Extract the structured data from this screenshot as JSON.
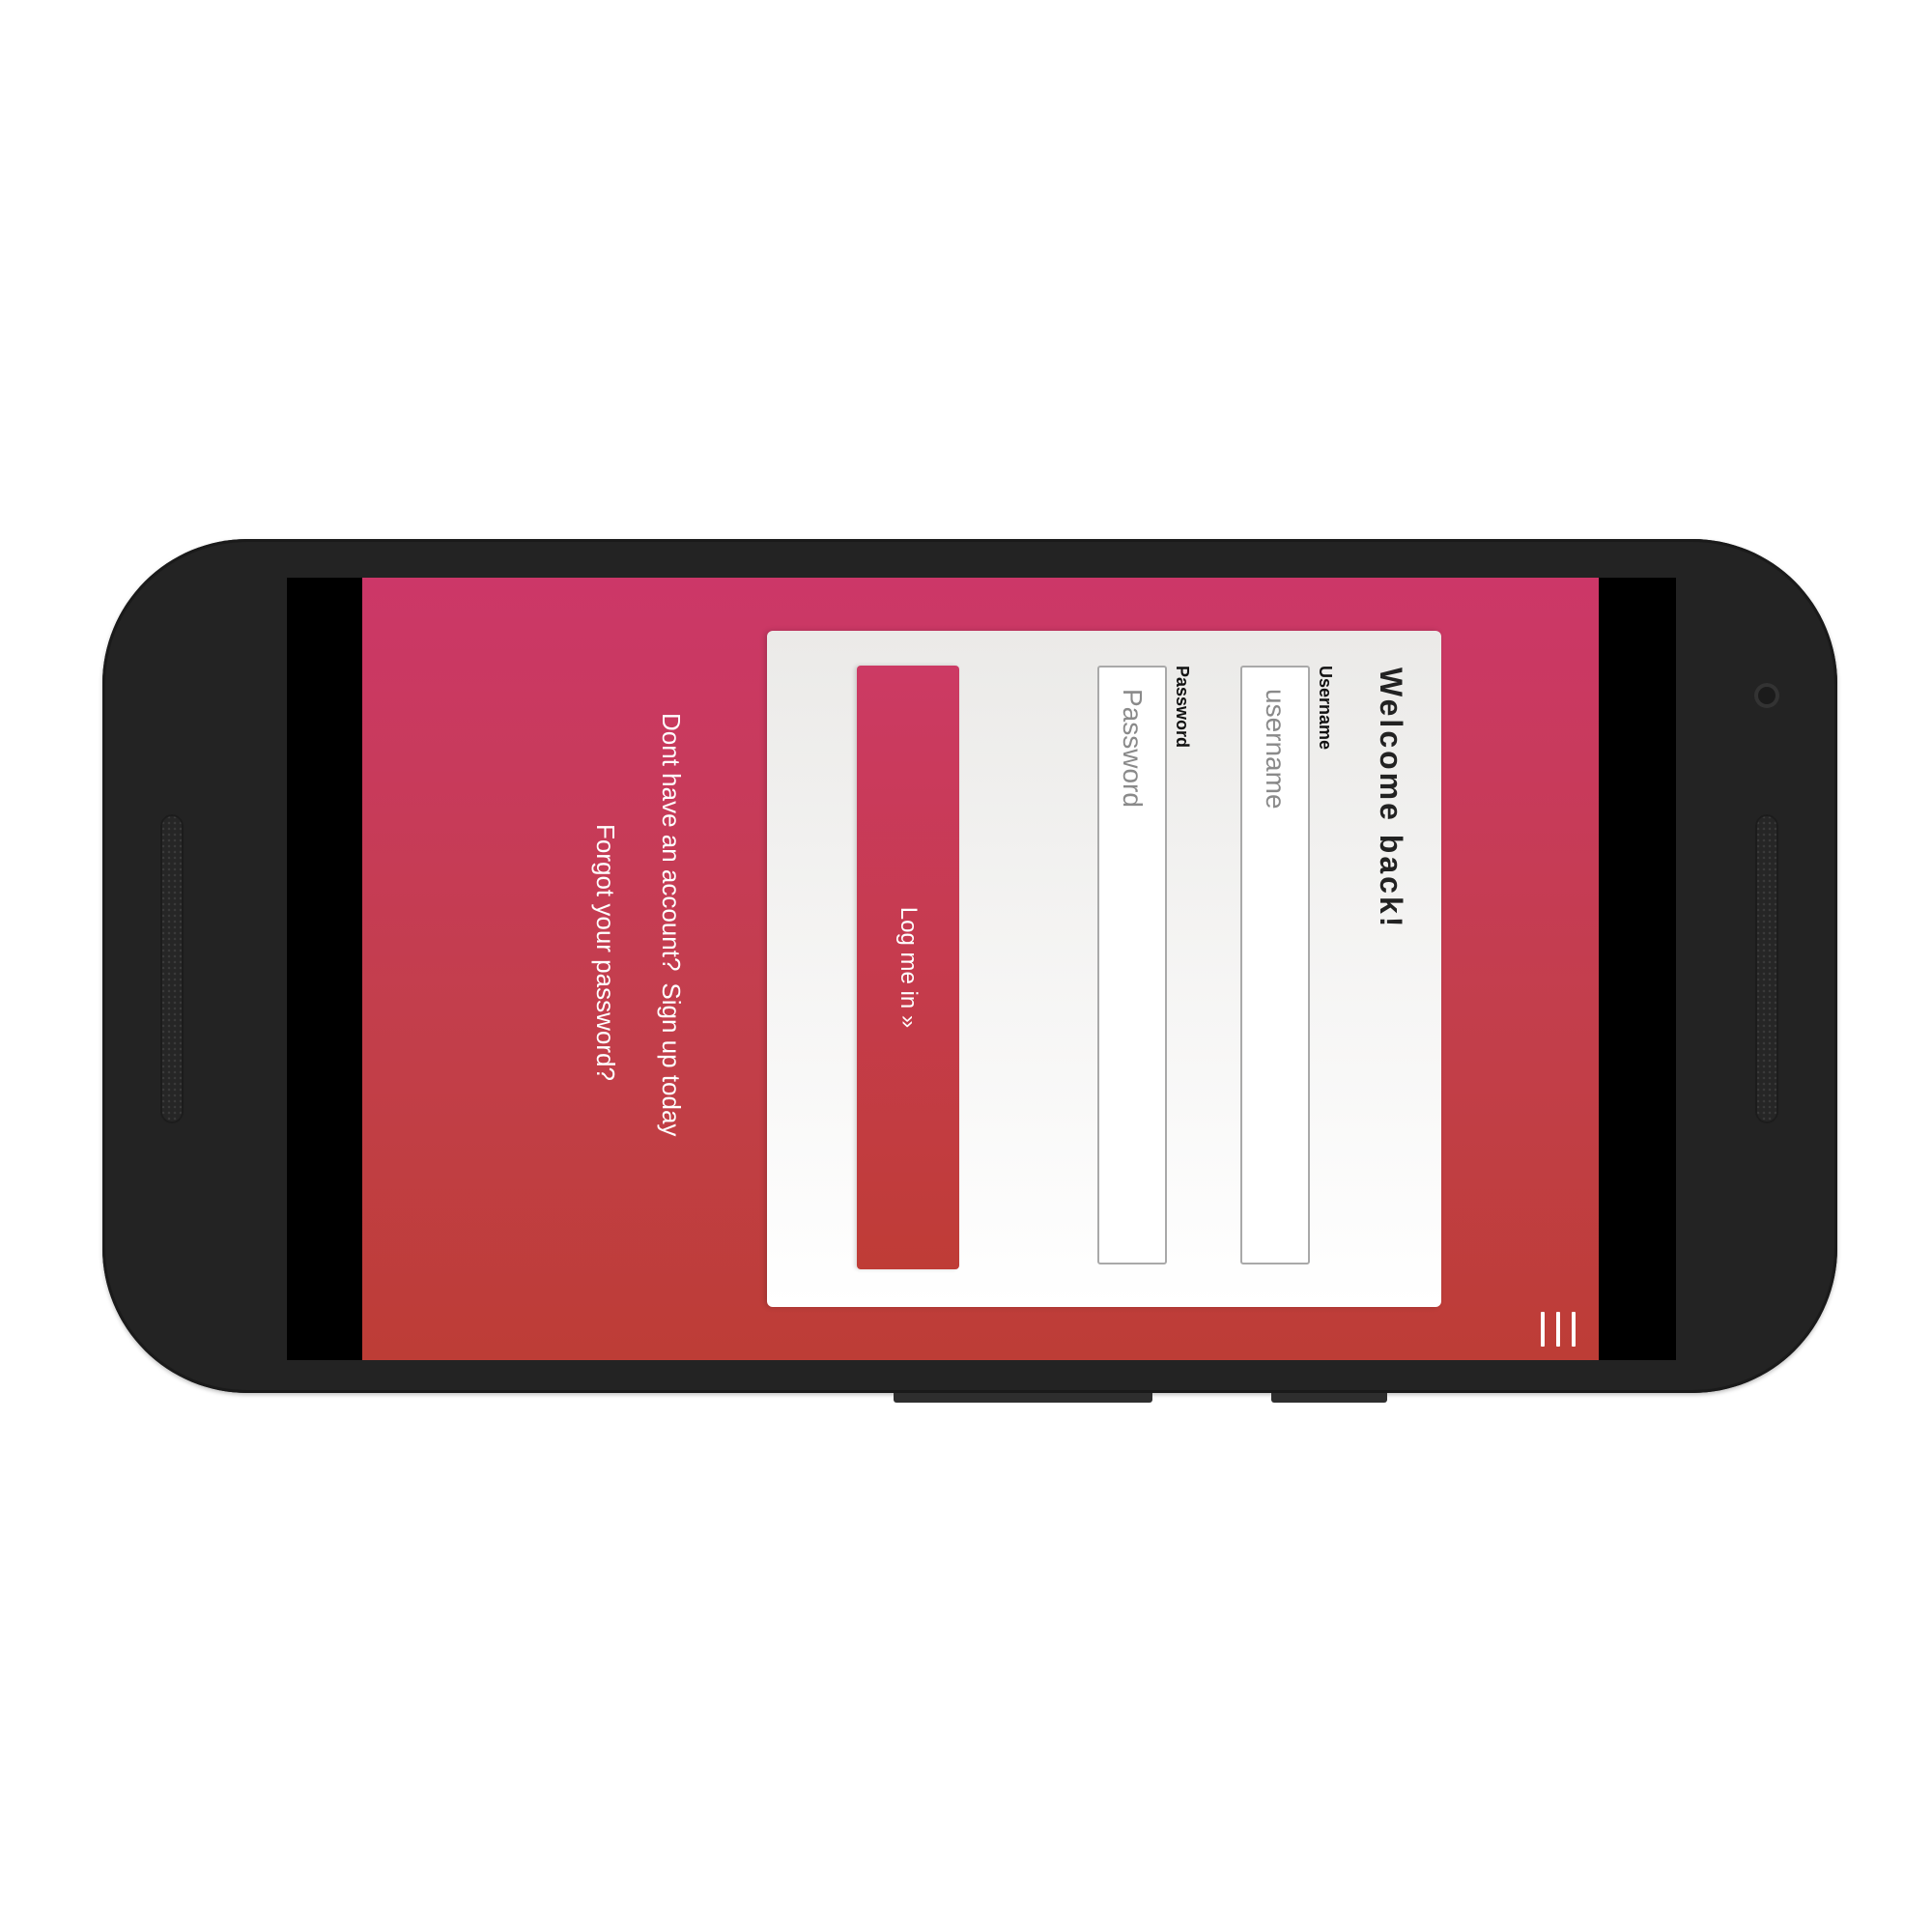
{
  "login": {
    "title": "Welcome back!",
    "username_label": "Username",
    "username_placeholder": "username",
    "password_label": "Password",
    "password_placeholder": "Password",
    "submit_label": "Log me in »"
  },
  "footer": {
    "no_account_text": "Dont have an account?",
    "signup_link": "Sign up today",
    "forgot_link": "Forgot your password?"
  },
  "colors": {
    "gradient_top": "#bd3d36",
    "gradient_bottom": "#cc3768",
    "device_body": "#232323"
  },
  "icons": {
    "menu": "hamburger-menu-icon"
  }
}
